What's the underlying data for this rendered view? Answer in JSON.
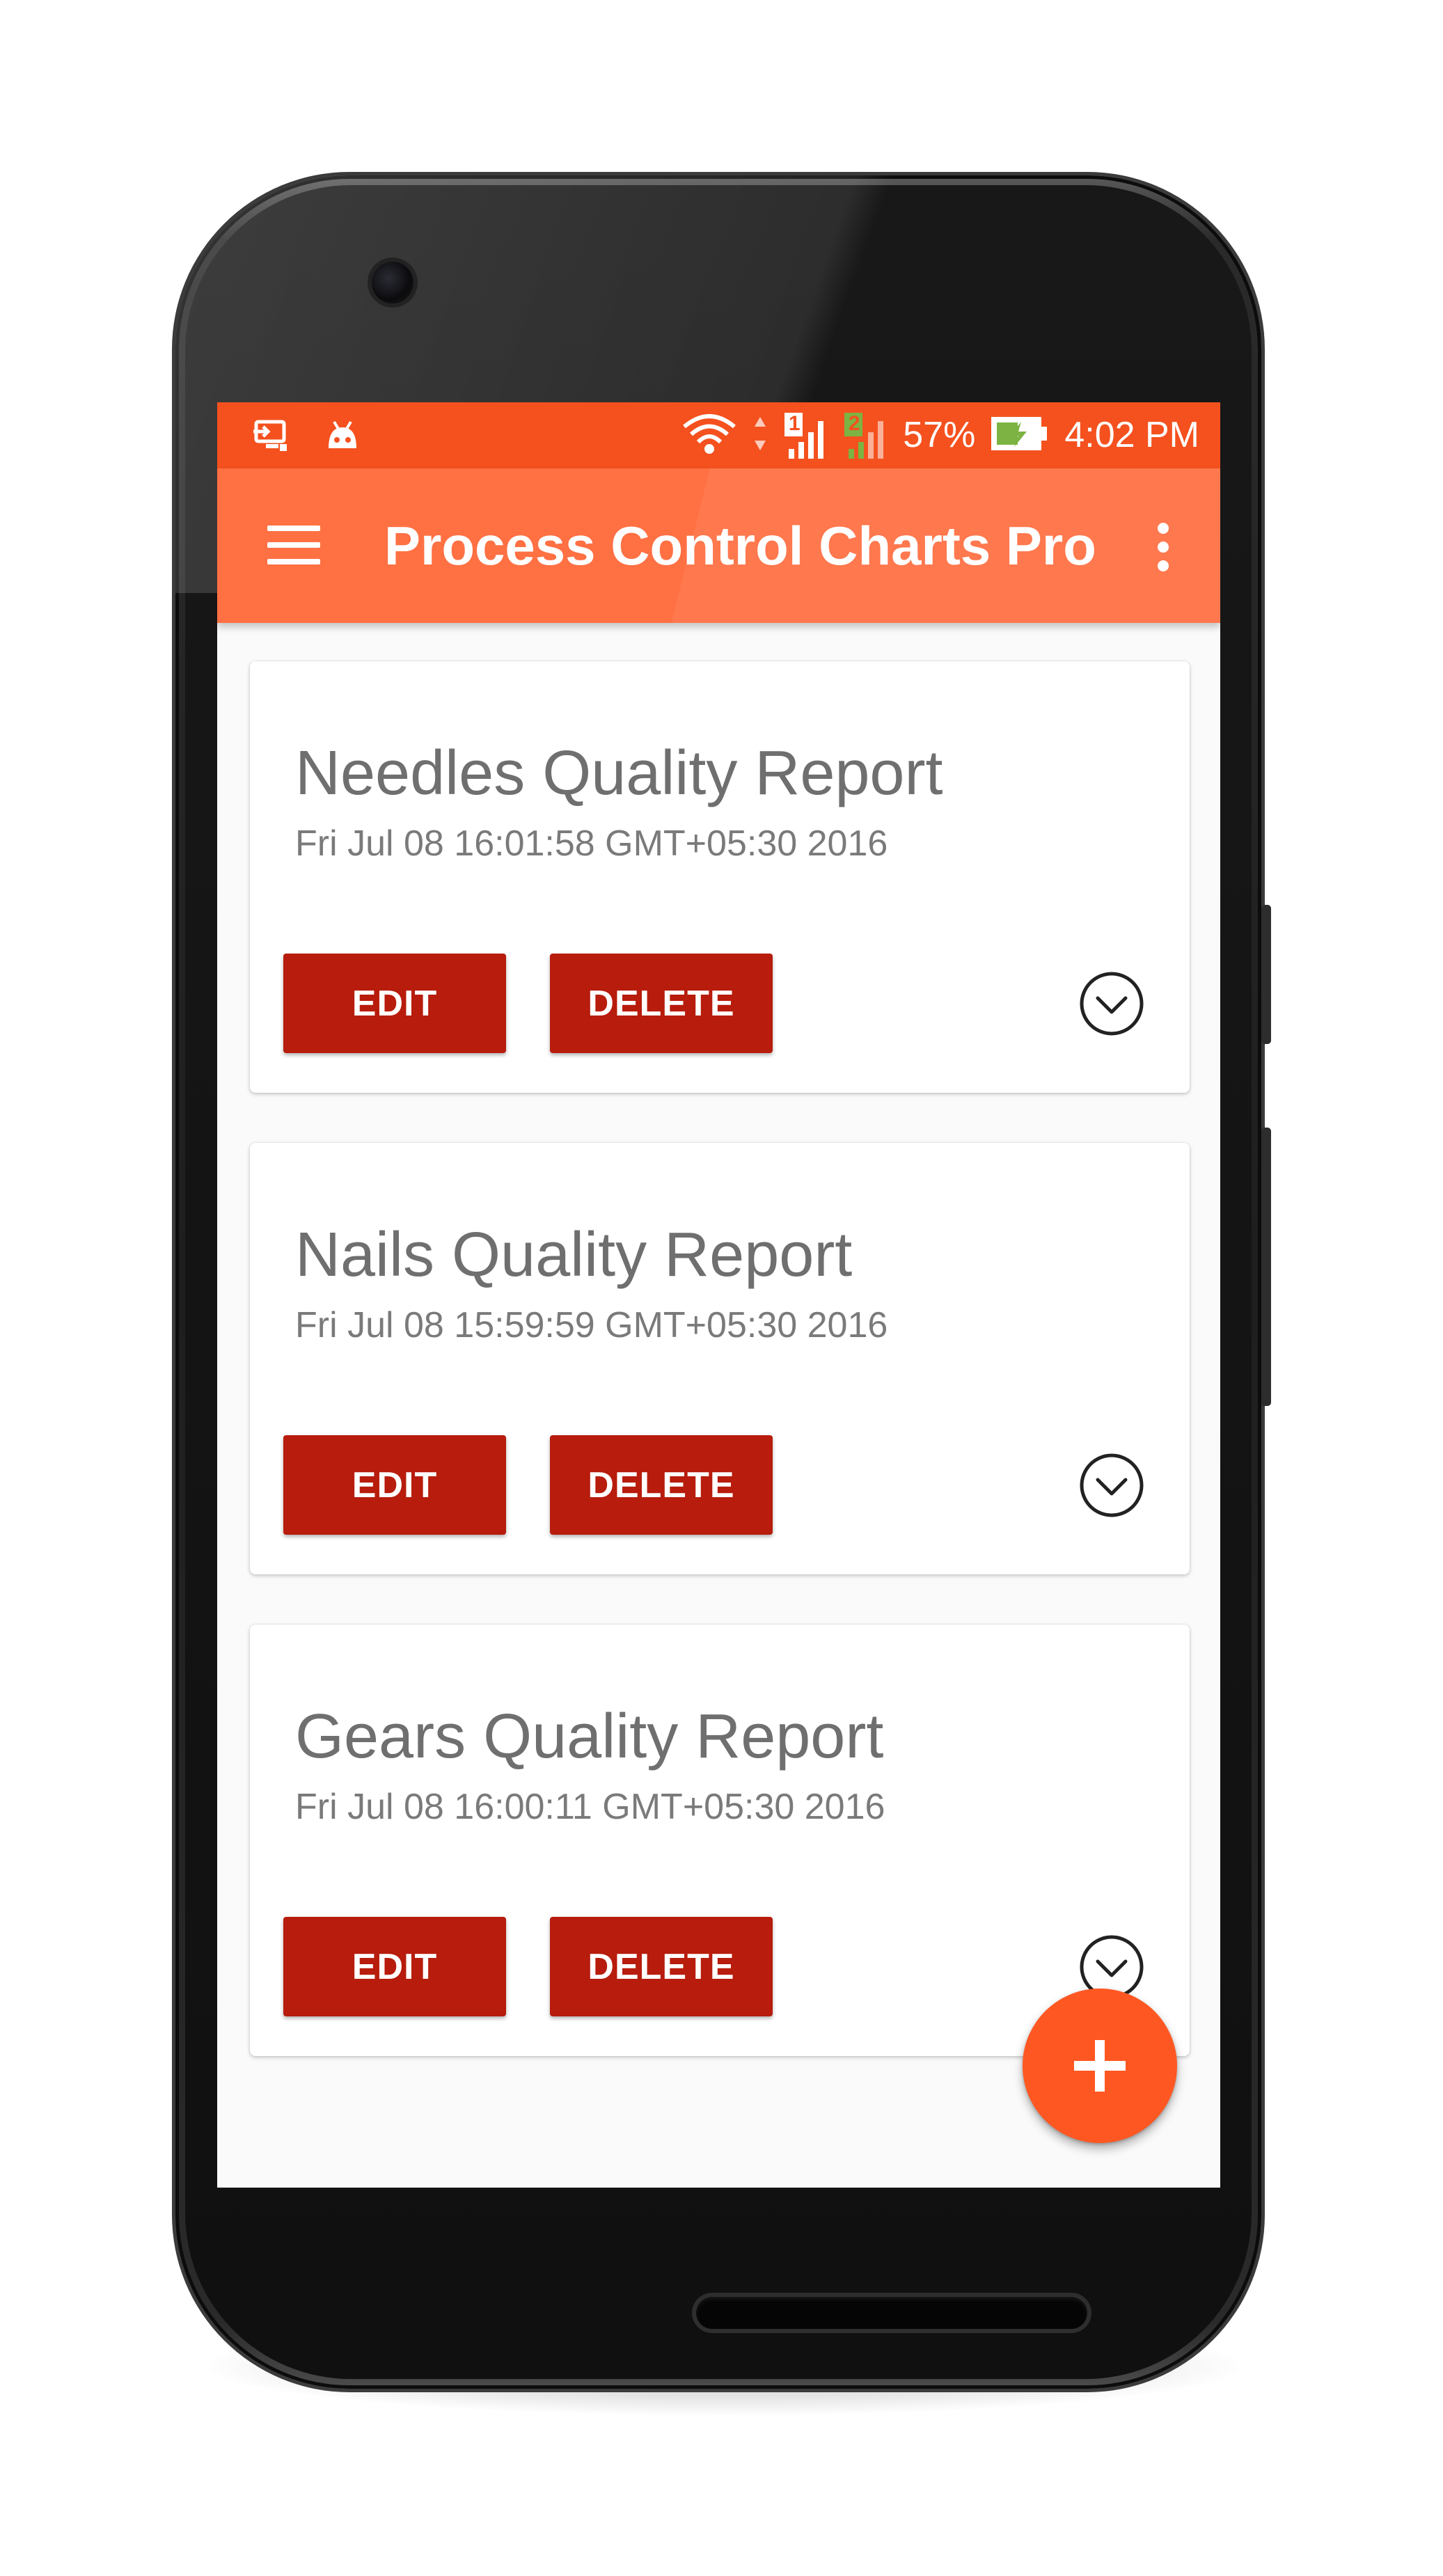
{
  "status_bar": {
    "battery_percent": "57%",
    "time": "4:02 PM",
    "sim1_label": "1",
    "sim2_label": "2",
    "icons": [
      "screen-cast-icon",
      "android-icon",
      "wifi-icon",
      "data-arrows-icon",
      "sim1-signal-icon",
      "sim2-signal-icon",
      "battery-charging-icon"
    ],
    "background_color": "#f4511e"
  },
  "app_bar": {
    "title": "Process Control Charts Pro",
    "menu_icon": "hamburger-menu-icon",
    "overflow_icon": "more-vert-icon",
    "background_color": "#ff7043"
  },
  "reports": [
    {
      "title": "Needles Quality Report",
      "date": "Fri Jul 08 16:01:58 GMT+05:30 2016",
      "edit_label": "EDIT",
      "delete_label": "DELETE"
    },
    {
      "title": "Nails Quality Report",
      "date": "Fri Jul 08 15:59:59 GMT+05:30 2016",
      "edit_label": "EDIT",
      "delete_label": "DELETE"
    },
    {
      "title": "Gears Quality Report",
      "date": "Fri Jul 08 16:00:11 GMT+05:30 2016",
      "edit_label": "EDIT",
      "delete_label": "DELETE"
    }
  ],
  "fab": {
    "icon": "add-icon",
    "color": "#ff5722"
  },
  "button_color": "#b71c0c"
}
